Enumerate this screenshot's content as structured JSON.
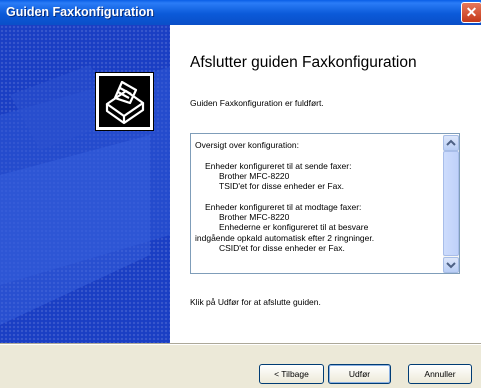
{
  "window": {
    "title": "Guiden Faxkonfiguration",
    "close_icon": "close-icon"
  },
  "main": {
    "heading": "Afslutter guiden Faxkonfiguration",
    "intro": "Guiden Faxkonfiguration er fuldført.",
    "summary": {
      "title": "Oversigt over konfiguration:",
      "send_header": "Enheder konfigureret til at sende faxer:",
      "send_device": "Brother MFC-8220",
      "send_tsid": "TSID'et for disse enheder er Fax.",
      "receive_header": "Enheder konfigureret til at modtage faxer:",
      "receive_device": "Brother MFC-8220",
      "receive_auto_1": "Enhederne er konfigureret til at besvare",
      "receive_auto_2": "indgående opkald automatisk efter 2 ringninger.",
      "receive_csid": "CSID'et for disse enheder er Fax."
    },
    "outro": "Klik på Udfør for at afslutte guiden."
  },
  "buttons": {
    "back": "< Tilbage",
    "finish": "Udfør",
    "cancel": "Annuller"
  },
  "icons": {
    "wizard": "fax-machine-icon",
    "scroll_up": "scroll-up-arrow-icon",
    "scroll_down": "scroll-down-arrow-icon"
  }
}
